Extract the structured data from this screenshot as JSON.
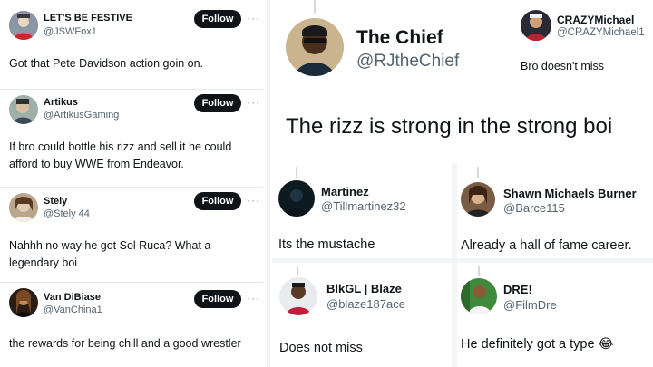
{
  "left_feed": {
    "tweets": [
      {
        "name": "LET'S BE FESTIVE",
        "handle": "@JSWFox1",
        "text": "Got that Pete Davidson action goin on.",
        "follow_label": "Follow",
        "more": "···"
      },
      {
        "name": "Artikus",
        "handle": "@ArtikusGaming",
        "text": "If bro could bottle his rizz and sell it he could afford to buy WWE from Endeavor.",
        "follow_label": "Follow",
        "more": "···"
      },
      {
        "name": "Stely",
        "handle": "@Stely 44",
        "text": "Nahhh no way he got Sol Ruca? What a legendary boi",
        "follow_label": "Follow",
        "more": "···"
      },
      {
        "name": "Van DiBiase",
        "handle": "@VanChina1",
        "text": "the rewards for being chill and a good wrestler",
        "follow_label": "Follow",
        "more": "···"
      }
    ]
  },
  "chief": {
    "name": "The Chief",
    "handle": "@RJtheChief"
  },
  "crazy": {
    "name": "CRAZYMichael",
    "handle": "@CRAZYMichael1",
    "text": "Bro doesn't miss"
  },
  "caption": {
    "text": "The rizz is strong in the strong boi"
  },
  "grid": {
    "martinez": {
      "name": "Martinez",
      "handle": "@Tillmartinez32",
      "text": "Its the mustache"
    },
    "shawn": {
      "name": "Shawn Michaels Burner",
      "handle": "@Barce115",
      "text": "Already a hall of fame career."
    },
    "blkgl": {
      "name": "BlkGL | Blaze",
      "handle": "@blaze187ace",
      "text": "Does not miss"
    },
    "dre": {
      "name": "DRE!",
      "handle": "@FilmDre",
      "text": "He definitely got a type 😂"
    }
  },
  "icons": {
    "more": "more-horizontal-icon",
    "avatars": [
      "avatar-icon"
    ]
  },
  "colors": {
    "text_primary": "#0f1419",
    "text_secondary": "#536471",
    "follow_bg": "#0f1419",
    "follow_text": "#ffffff",
    "divider": "#e6e9ec"
  }
}
